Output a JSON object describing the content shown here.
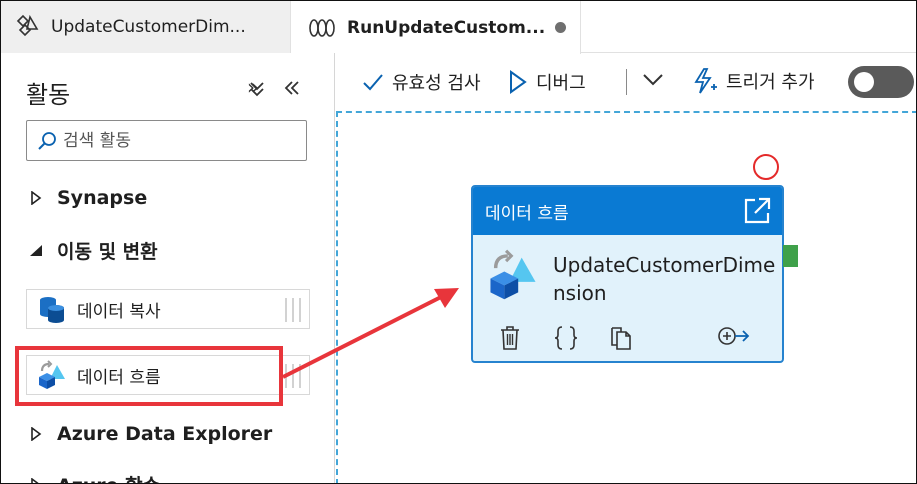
{
  "tabs": [
    {
      "label": "UpdateCustomerDim...",
      "icon": "dataflow-icon",
      "active": false
    },
    {
      "label": "RunUpdateCustom...",
      "icon": "pipeline-icon",
      "active": true,
      "unsaved": true
    }
  ],
  "sidebar": {
    "title": "활동",
    "collapse_icons": [
      "expand-all-icon",
      "collapse-panel-icon"
    ],
    "search": {
      "placeholder": "검색 활동",
      "value": ""
    },
    "groups": [
      {
        "label": "Synapse",
        "expanded": false
      },
      {
        "label": "이동 및 변환",
        "expanded": true
      },
      {
        "label": "Azure Data Explorer",
        "expanded": false
      },
      {
        "label": "Azure 함수",
        "expanded": false
      }
    ],
    "activities": [
      {
        "label": "데이터 복사",
        "icon": "copy-data-icon"
      },
      {
        "label": "데이터 흐름",
        "icon": "dataflow-icon",
        "highlighted": true
      }
    ]
  },
  "toolbar": {
    "validate_label": "유효성 검사",
    "debug_label": "디버그",
    "trigger_label": "트리거 추가",
    "toggle_on": false
  },
  "canvas": {
    "node": {
      "header": "데이터 흐름",
      "name": "UpdateCustomerDimension",
      "actions": [
        "delete-icon",
        "code-icon",
        "copy-icon",
        "add-output-icon"
      ]
    }
  },
  "colors": {
    "accent": "#0a7ad3",
    "highlight": "#e8353b",
    "node_bg": "#e1f2fb",
    "success_port": "#3fa14a"
  }
}
